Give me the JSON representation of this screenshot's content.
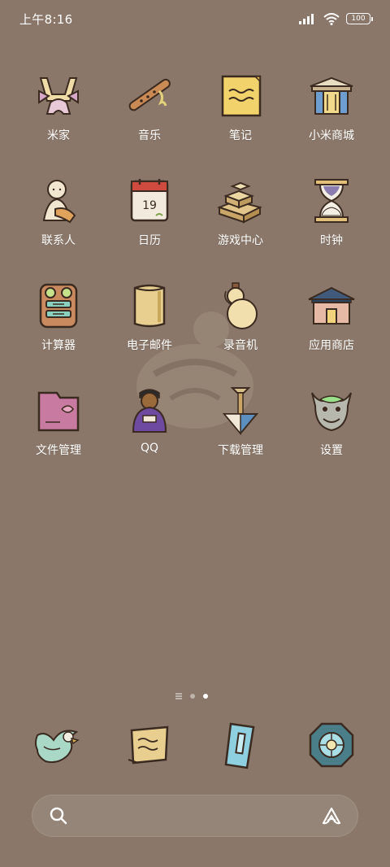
{
  "status_bar": {
    "time": "上午8:16",
    "battery": "100"
  },
  "apps": [
    {
      "label": "米家",
      "icon": "mijia-icon"
    },
    {
      "label": "音乐",
      "icon": "flute-icon"
    },
    {
      "label": "笔记",
      "icon": "notes-icon"
    },
    {
      "label": "小米商城",
      "icon": "shop-gate-icon"
    },
    {
      "label": "联系人",
      "icon": "figure-icon"
    },
    {
      "label": "日历",
      "icon": "calendar-icon",
      "badge": "19"
    },
    {
      "label": "游戏中心",
      "icon": "blocks-icon"
    },
    {
      "label": "时钟",
      "icon": "hourglass-icon"
    },
    {
      "label": "计算器",
      "icon": "calculator-icon"
    },
    {
      "label": "电子邮件",
      "icon": "scroll-icon"
    },
    {
      "label": "录音机",
      "icon": "gourd-icon"
    },
    {
      "label": "应用商店",
      "icon": "house-icon"
    },
    {
      "label": "文件管理",
      "icon": "folder-icon"
    },
    {
      "label": "QQ",
      "icon": "doll-icon"
    },
    {
      "label": "下载管理",
      "icon": "shovel-icon"
    },
    {
      "label": "设置",
      "icon": "beast-mask-icon"
    }
  ],
  "dock": [
    {
      "icon": "eagle-icon"
    },
    {
      "icon": "letter-scroll-icon"
    },
    {
      "icon": "jade-tablet-icon"
    },
    {
      "icon": "octagon-ornament-icon"
    }
  ],
  "pager": {
    "pages": 2,
    "active": 2
  },
  "colors": {
    "background": "#8a7769"
  }
}
